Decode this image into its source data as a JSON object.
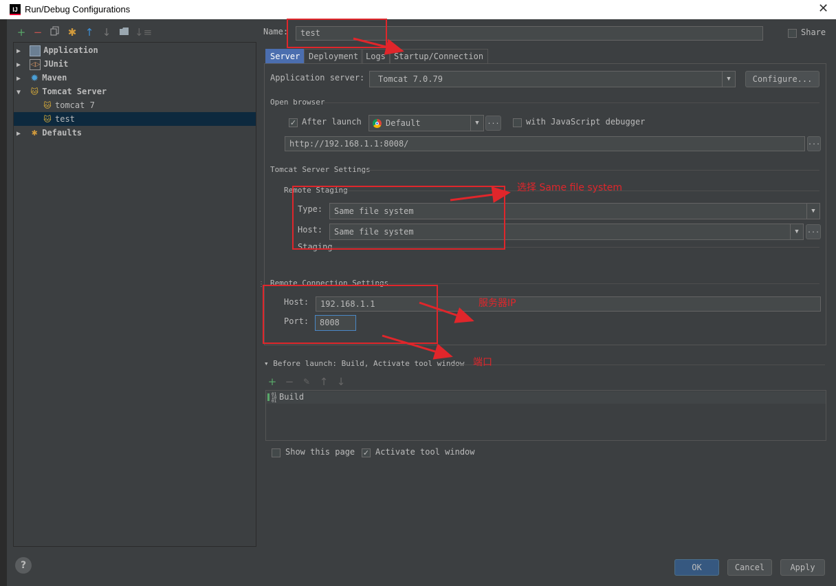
{
  "window": {
    "title": "Run/Debug Configurations",
    "close_glyph": "✕",
    "app_icon_text": "IJ"
  },
  "toolbar": [
    "add-icon",
    "remove-icon",
    "copy-icon",
    "wrench-icon",
    "arrow-up-icon",
    "arrow-down-icon",
    "folder-icon",
    "sort-icon"
  ],
  "tree": {
    "items": [
      {
        "label": "Application",
        "arrow": "▶",
        "icon": "application-icon"
      },
      {
        "label": "JUnit",
        "arrow": "▶",
        "icon": "junit-icon"
      },
      {
        "label": "Maven",
        "arrow": "▶",
        "icon": "maven-icon"
      },
      {
        "label": "Tomcat Server",
        "arrow": "▼",
        "icon": "tomcat-icon"
      },
      {
        "label": "tomcat 7",
        "arrow": "",
        "icon": "tomcat-icon"
      },
      {
        "label": "test",
        "arrow": "",
        "icon": "tomcat-icon",
        "selected": true
      },
      {
        "label": "Defaults",
        "arrow": "▶",
        "icon": "wrench-icon"
      }
    ]
  },
  "name_row": {
    "label": "Name:",
    "value": "test",
    "share_label": "Share"
  },
  "tabs": [
    "Server",
    "Deployment",
    "Logs",
    "Startup/Connection"
  ],
  "server": {
    "app_server_label": "Application server:",
    "app_server_value": "Tomcat 7.0.79",
    "configure_label": "Configure...",
    "open_browser_title": "Open browser",
    "after_launch_label": "After launch",
    "browser_value": "Default",
    "ellipsis": "...",
    "js_debugger_label": "with JavaScript debugger",
    "url_value": "http://192.168.1.1:8008/",
    "tomcat_settings_title": "Tomcat Server Settings",
    "remote_staging_title": "Remote Staging",
    "type_label": "Type:",
    "type_value": "Same file system",
    "host_label": "Host:",
    "host_value": "Same file system",
    "staging_label": "Staging",
    "remote_conn_title": "Remote Connection Settings",
    "conn_host_label": "Host:",
    "conn_host_value": "192.168.1.1",
    "conn_port_label": "Port:",
    "conn_port_value": "8008"
  },
  "before_launch": {
    "title": "Before launch: Build, Activate tool window",
    "items": [
      "Build"
    ]
  },
  "footer": {
    "show_page_label": "Show this page",
    "activate_label": "Activate tool window",
    "ok": "OK",
    "cancel": "Cancel",
    "apply": "Apply",
    "help": "?"
  },
  "annotations": {
    "select_same_fs": "选择 Same file system",
    "server_ip": "服务器IP",
    "port": "端口",
    "color": "#e0262b"
  }
}
